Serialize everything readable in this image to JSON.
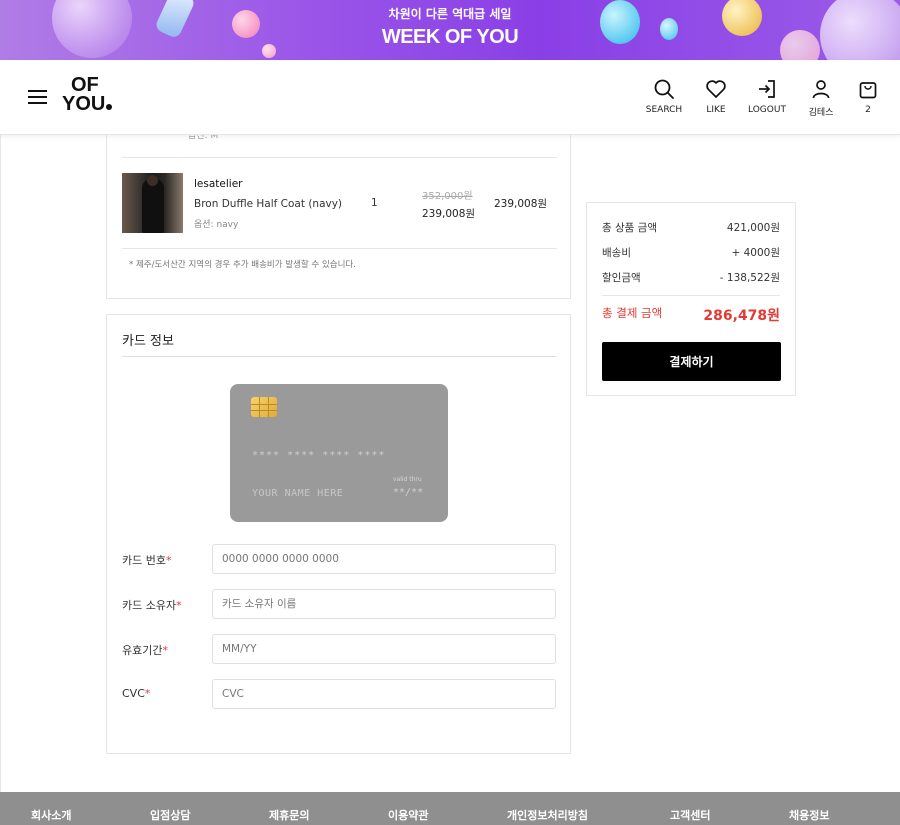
{
  "promo": {
    "kicker": "차원이 다른 역대급 세일",
    "headline": "WEEK OF YOU"
  },
  "header": {
    "logo_line1": "OF",
    "logo_line2": "YOU",
    "nav": [
      {
        "icon": "search-icon",
        "label": "SEARCH"
      },
      {
        "icon": "heart-icon",
        "label": "LIKE"
      },
      {
        "icon": "logout-icon",
        "label": "LOGOUT"
      },
      {
        "icon": "user-icon",
        "label": "김테스"
      },
      {
        "icon": "shopping-bag-icon",
        "label": "2"
      }
    ]
  },
  "order": {
    "prev_item_option_faded": "옵션: M",
    "item": {
      "brand": "lesatelier",
      "name": "Bron Duffle Half Coat (navy)",
      "option": "옵션: navy",
      "quantity": "1",
      "original_price": "352,000원",
      "sale_price": "239,008원",
      "line_total": "239,008원"
    },
    "shipping_notice": "* 제주/도서산간 지역의 경우 추가 배송비가 발생할 수 있습니다."
  },
  "card_info": {
    "title": "카드 정보",
    "preview": {
      "number_mask": "**** **** **** ****",
      "holder_placeholder": "YOUR NAME HERE",
      "valid_thru_label": "valid thru",
      "expiry_mask": "**/**"
    },
    "fields": [
      {
        "label": "카드 번호",
        "required_mark": "*",
        "placeholder": "0000 0000 0000 0000"
      },
      {
        "label": "카드 소유자",
        "required_mark": "*",
        "placeholder": "카드 소유자 이름"
      },
      {
        "label": "유효기간",
        "required_mark": "*",
        "placeholder": "MM/YY"
      },
      {
        "label": "CVC",
        "required_mark": "*",
        "placeholder": "CVC"
      }
    ]
  },
  "summary": {
    "rows": [
      {
        "label": "총 상품 금액",
        "value": "421,000원"
      },
      {
        "label": "배송비",
        "value": "+ 4000원"
      },
      {
        "label": "할인금액",
        "value": "- 138,522원"
      }
    ],
    "total_label": "총 결제 금액",
    "total_value": "286,478원",
    "pay_button": "결제하기"
  },
  "footer": {
    "links": [
      "회사소개",
      "입점상담",
      "제휴문의",
      "이용약관",
      "개인정보처리방침",
      "고객센터",
      "채용정보"
    ]
  },
  "colors": {
    "accent_red": "#e53935",
    "promo_purple": "#9a55e8",
    "footer_gray": "#8f8f8f",
    "card_gray": "#9a9a9a"
  }
}
